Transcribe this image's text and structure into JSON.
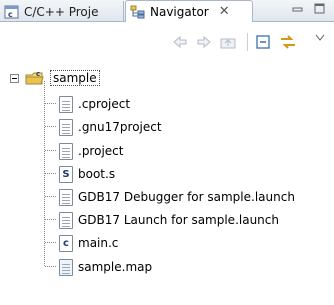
{
  "tabs": [
    {
      "label": "C/C++ Proje",
      "icon": "cpp-projects-icon",
      "active": false
    },
    {
      "label": "Navigator",
      "icon": "navigator-icon",
      "active": true
    }
  ],
  "window_controls": [
    "minimize-icon",
    "maximize-icon"
  ],
  "toolbar": [
    "back-icon",
    "forward-icon",
    "up-folder-icon",
    "collapse-all-icon",
    "link-with-editor-icon",
    "view-menu-icon"
  ],
  "tree": {
    "root": {
      "label": "sample",
      "icon": "c-project-folder-icon",
      "expanded": true
    },
    "children": [
      {
        "label": ".cproject",
        "icon": "text-file-icon"
      },
      {
        "label": ".gnu17project",
        "icon": "text-file-icon"
      },
      {
        "label": ".project",
        "icon": "text-file-icon"
      },
      {
        "label": "boot.s",
        "icon": "assembly-file-icon",
        "glyph": "S"
      },
      {
        "label": "GDB17 Debugger for sample.launch",
        "icon": "text-file-icon"
      },
      {
        "label": "GDB17 Launch for sample.launch",
        "icon": "text-file-icon"
      },
      {
        "label": "main.c",
        "icon": "c-source-file-icon",
        "glyph": "c"
      },
      {
        "label": "sample.map",
        "icon": "map-file-icon"
      }
    ]
  }
}
